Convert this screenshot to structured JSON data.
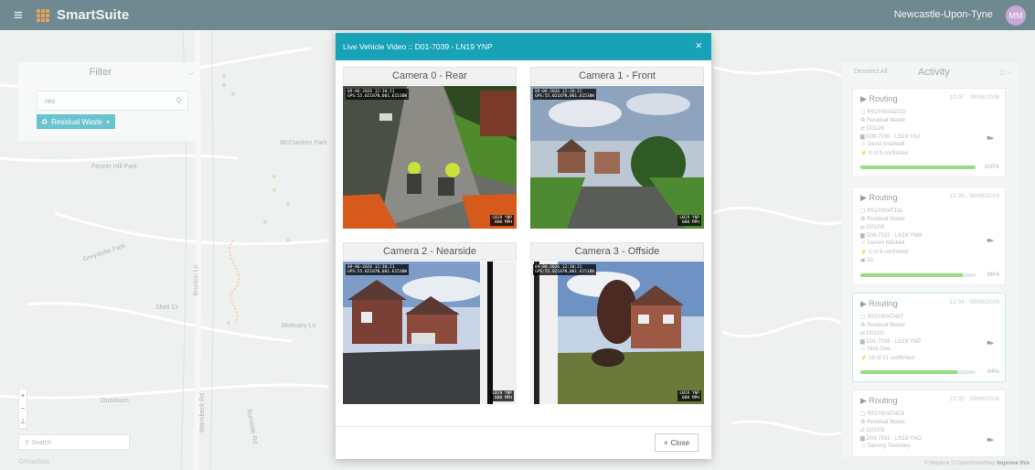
{
  "app": {
    "name": "SmartSuite",
    "location": "Newcastle-Upon-Tyne",
    "user_initials": "MM"
  },
  "colors": {
    "topbar": "#6e8a90",
    "accent": "#17a2b8",
    "chip": "#41b6c4",
    "progress": "#7ed66a",
    "logo": "#e8a25a"
  },
  "icons": {
    "menu": "hamburger-icon",
    "search": "search-icon",
    "close": "close-icon",
    "camera": "video-camera-icon"
  },
  "filter": {
    "title": "Filter",
    "search_value": "res",
    "chip_label": "Residual Waste",
    "chip_close": "×"
  },
  "map": {
    "labels": [
      "Fencer Hill Park",
      "McCracken Park",
      "Greystoke Park",
      "Mortuary Ln",
      "Ouseburn",
      "Burnside Rd",
      "Brunton Ln",
      "Wansbeck Rd",
      "Shiel Ct"
    ],
    "search_placeholder": "Search",
    "zoom_in": "+",
    "zoom_out": "−",
    "compass": "⊥",
    "mapbox": "©mapbox",
    "attribution_prefix": "© Mapbox © OpenStreetMap",
    "attribution_link": "Improve this"
  },
  "activity": {
    "title": "Activity",
    "deselect": "Deselect All",
    "cards": [
      {
        "type": "Routing",
        "time": "12:07 · 09/06/2026",
        "code": "RS2Y60A5ZGD",
        "waste": "Residual Waste",
        "round": "D01/28",
        "vehicle": "D08-7030 · LN19 YNJ",
        "driver": "David Gradwell",
        "confirmed": "0 of 9 confirmed",
        "extra": "",
        "progress": 1.0,
        "pct": "100%"
      },
      {
        "type": "Routing",
        "time": "12:35 · 09/06/2026",
        "code": "RS2Y60AT16L",
        "waste": "Residual Waste",
        "round": "D01/09",
        "vehicle": "D09-7032 · LN19 YNM",
        "driver": "Darren Mitchell",
        "confirmed": "5 of 8 confirmed",
        "extra": "50",
        "progress": 0.89,
        "pct": "89%"
      },
      {
        "type": "Routing",
        "time": "12:34 · 09/06/2026",
        "code": "RS2Y60AT45T",
        "waste": "Residual Waste",
        "round": "D01/01",
        "vehicle": "D01-7039 · LN19 YNP",
        "driver": "Nick Gee",
        "confirmed": "19 of 21 confirmed",
        "extra": "",
        "progress": 0.84,
        "pct": "84%"
      },
      {
        "type": "Routing",
        "time": "12:35 · 09/06/2026",
        "code": "RS2Y60AT4C6",
        "waste": "Residual Waste",
        "round": "D01/03",
        "vehicle": "D03-7031 · LN19 YNO",
        "driver": "Sammy Townsley",
        "confirmed": "",
        "extra": "",
        "progress": 0,
        "pct": ""
      }
    ]
  },
  "modal": {
    "title": "Live Vehicle Video :: D01-7039 - LN19 YNP",
    "close_x": "×",
    "close_button": "Close",
    "close_button_icon": "×",
    "cameras": [
      {
        "title": "Camera 0 - Rear",
        "osd": "09-06-2026 12:30:21\nGPS:55.02187N,001.61530W",
        "osd2": "LN19 YNP\n000 MPH"
      },
      {
        "title": "Camera 1 - Front",
        "osd": "09-06-2026 12:30:21\nGPS:55.02187N,001.61530W",
        "osd2": "LN19 YNP\n000 MPH"
      },
      {
        "title": "Camera 2 - Nearside",
        "osd": "09-06-2026 12:30:21\nGPS:55.02187N,001.61530W",
        "osd2": "LN19 YNP\n000 MPH"
      },
      {
        "title": "Camera 3 - Offside",
        "osd": "09-06-2026 12:30:21\nGPS:55.02187N,001.61530W",
        "osd2": "LN19 YNP\n000 MPH"
      }
    ]
  }
}
